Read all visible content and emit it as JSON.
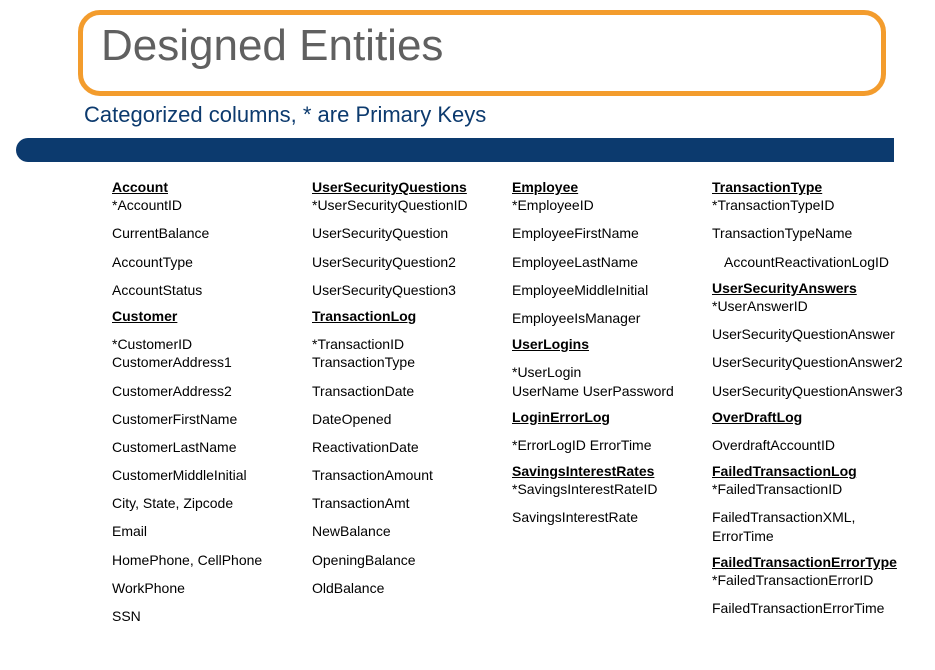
{
  "title": "Designed Entities",
  "subtitle": "Categorized columns, * are Primary Keys",
  "columns": [
    [
      {
        "type": "entity",
        "text": "Account",
        "first": true
      },
      {
        "type": "field",
        "text": "*AccountID",
        "tight": true
      },
      {
        "type": "field",
        "text": "CurrentBalance"
      },
      {
        "type": "field",
        "text": "AccountType"
      },
      {
        "type": "field",
        "text": "AccountStatus"
      },
      {
        "type": "entity",
        "text": "Customer"
      },
      {
        "type": "field",
        "text": "*CustomerID"
      },
      {
        "type": "field",
        "text": "CustomerAddress1",
        "tight": true
      },
      {
        "type": "field",
        "text": "CustomerAddress2"
      },
      {
        "type": "field",
        "text": "CustomerFirstName"
      },
      {
        "type": "field",
        "text": "CustomerLastName"
      },
      {
        "type": "field",
        "text": "CustomerMiddleInitial"
      },
      {
        "type": "field",
        "text": "City, State, Zipcode"
      },
      {
        "type": "field",
        "text": "Email"
      },
      {
        "type": "field",
        "text": "HomePhone, CellPhone"
      },
      {
        "type": "field",
        "text": "WorkPhone"
      },
      {
        "type": "field",
        "text": "SSN"
      }
    ],
    [
      {
        "type": "entity",
        "text": "UserSecurityQuestions",
        "first": true
      },
      {
        "type": "field",
        "text": "*UserSecurityQuestionID",
        "tight": true
      },
      {
        "type": "field",
        "text": "UserSecurityQuestion"
      },
      {
        "type": "field",
        "text": "UserSecurityQuestion2"
      },
      {
        "type": "field",
        "text": "UserSecurityQuestion3"
      },
      {
        "type": "entity",
        "text": "TransactionLog"
      },
      {
        "type": "field",
        "text": "*TransactionID"
      },
      {
        "type": "field",
        "text": "TransactionType",
        "tight": true
      },
      {
        "type": "field",
        "text": "TransactionDate"
      },
      {
        "type": "field",
        "text": "DateOpened"
      },
      {
        "type": "field",
        "text": "ReactivationDate"
      },
      {
        "type": "field",
        "text": "TransactionAmount"
      },
      {
        "type": "field",
        "text": "TransactionAmt"
      },
      {
        "type": "field",
        "text": "NewBalance"
      },
      {
        "type": "field",
        "text": "OpeningBalance"
      },
      {
        "type": "field",
        "text": "OldBalance"
      }
    ],
    [
      {
        "type": "entity",
        "text": "Employee",
        "first": true
      },
      {
        "type": "field",
        "text": "*EmployeeID",
        "tight": true
      },
      {
        "type": "field",
        "text": "EmployeeFirstName"
      },
      {
        "type": "field",
        "text": "EmployeeLastName"
      },
      {
        "type": "field",
        "text": "EmployeeMiddleInitial"
      },
      {
        "type": "field",
        "text": "EmployeeIsManager"
      },
      {
        "type": "entity",
        "text": "UserLogins"
      },
      {
        "type": "field",
        "text": "*UserLogin"
      },
      {
        "type": "field",
        "text": "UserName  UserPassword",
        "tight": true
      },
      {
        "type": "entity",
        "text": "LoginErrorLog"
      },
      {
        "type": "field",
        "text": "*ErrorLogID  ErrorTime"
      },
      {
        "type": "entity",
        "text": "SavingsInterestRates"
      },
      {
        "type": "field",
        "text": "*SavingsInterestRateID",
        "tight": true
      },
      {
        "type": "field",
        "text": "SavingsInterestRate"
      }
    ],
    [
      {
        "type": "entity",
        "text": "TransactionType",
        "first": true
      },
      {
        "type": "field",
        "text": "*TransactionTypeID",
        "tight": true
      },
      {
        "type": "field",
        "text": "TransactionTypeName"
      },
      {
        "type": "field",
        "text": "AccountReactivationLogID",
        "indent": true
      },
      {
        "type": "entity",
        "text": "UserSecurityAnswers"
      },
      {
        "type": "field",
        "text": "*UserAnswerID",
        "tight": true
      },
      {
        "type": "field",
        "text": "UserSecurityQuestionAnswer"
      },
      {
        "type": "field",
        "text": "UserSecurityQuestionAnswer2"
      },
      {
        "type": "field",
        "text": "UserSecurityQuestionAnswer3"
      },
      {
        "type": "entity",
        "text": "OverDraftLog"
      },
      {
        "type": "field",
        "text": "OverdraftAccountID"
      },
      {
        "type": "entity",
        "text": "FailedTransactionLog"
      },
      {
        "type": "field",
        "text": "*FailedTransactionID",
        "tight": true
      },
      {
        "type": "field",
        "text": "FailedTransactionXML, ErrorTime"
      },
      {
        "type": "entity",
        "text": "FailedTransactionErrorType"
      },
      {
        "type": "field",
        "text": "*FailedTransactionErrorID",
        "tight": true
      },
      {
        "type": "field",
        "text": "FailedTransactionErrorTime"
      }
    ]
  ]
}
